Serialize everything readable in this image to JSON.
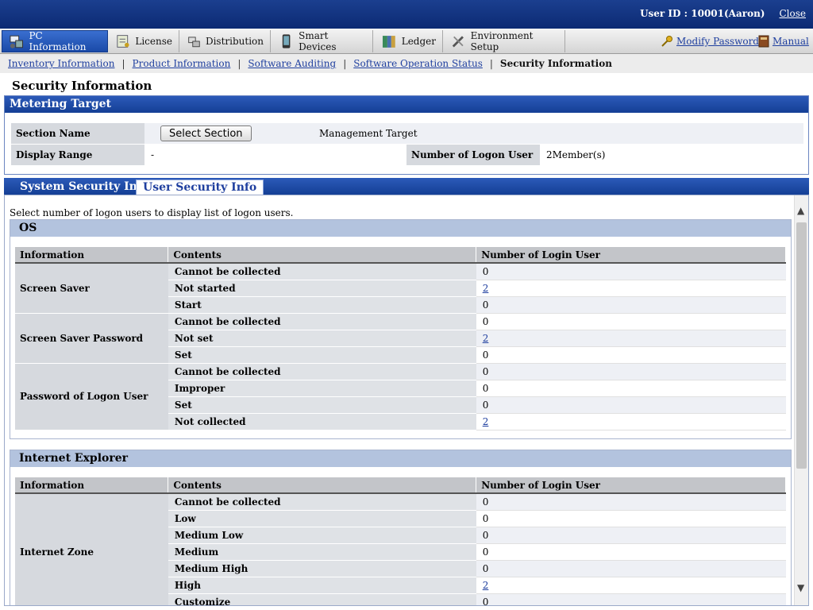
{
  "header": {
    "user_label": "User ID : 10001(Aaron)",
    "close_label": "Close"
  },
  "tabs": [
    {
      "label": "PC Information",
      "icon": "pc-icon"
    },
    {
      "label": "License",
      "icon": "license-icon"
    },
    {
      "label": "Distribution",
      "icon": "distribution-icon"
    },
    {
      "label": "Smart Devices",
      "icon": "smart-device-icon"
    },
    {
      "label": "Ledger",
      "icon": "ledger-icon"
    },
    {
      "label": "Environment Setup",
      "icon": "tools-icon"
    }
  ],
  "tab_right": {
    "modify_password": "Modify Password",
    "manual": "Manual"
  },
  "subnav": [
    "Inventory Information",
    "Product Information",
    "Software Auditing",
    "Software Operation Status",
    "Security Information"
  ],
  "page_title": "Security Information",
  "metering": {
    "title": "Metering Target",
    "section_name_label": "Section Name",
    "select_section_btn": "Select Section",
    "management_target": "Management Target",
    "display_range_label": "Display Range",
    "display_range_value": "-",
    "logon_user_label": "Number of Logon User",
    "logon_user_value": "2Member(s)"
  },
  "subtabs": [
    "System Security Info",
    "User Security Info"
  ],
  "hint": "Select number of logon users to display list of logon users.",
  "columns": [
    "Information",
    "Contents",
    "Number of Login User"
  ],
  "os": {
    "title": "OS",
    "groups": [
      {
        "name": "Screen Saver",
        "rows": [
          [
            "Cannot be collected",
            "0"
          ],
          [
            "Not started",
            "2"
          ],
          [
            "Start",
            "0"
          ]
        ]
      },
      {
        "name": "Screen Saver Password",
        "rows": [
          [
            "Cannot be collected",
            "0"
          ],
          [
            "Not set",
            "2"
          ],
          [
            "Set",
            "0"
          ]
        ]
      },
      {
        "name": "Password of Logon User",
        "rows": [
          [
            "Cannot be collected",
            "0"
          ],
          [
            "Improper",
            "0"
          ],
          [
            "Set",
            "0"
          ],
          [
            "Not collected",
            "2"
          ]
        ]
      }
    ]
  },
  "ie": {
    "title": "Internet Explorer",
    "groups": [
      {
        "name": "Internet Zone",
        "rows": [
          [
            "Cannot be collected",
            "0"
          ],
          [
            "Low",
            "0"
          ],
          [
            "Medium Low",
            "0"
          ],
          [
            "Medium",
            "0"
          ],
          [
            "Medium High",
            "0"
          ],
          [
            "High",
            "2"
          ],
          [
            "Customize",
            "0"
          ]
        ]
      }
    ]
  }
}
